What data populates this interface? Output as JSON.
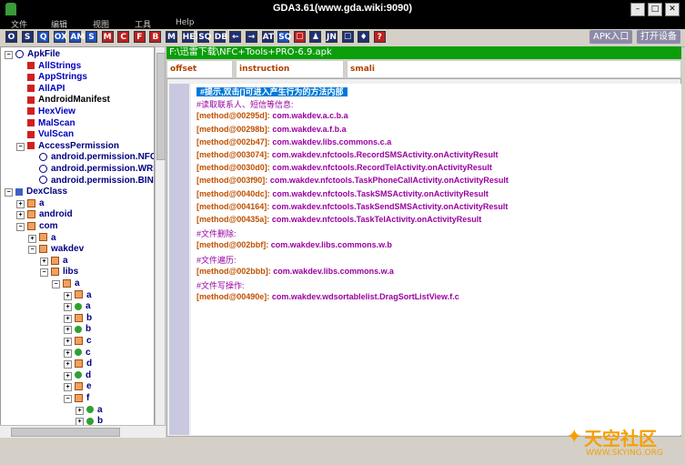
{
  "window": {
    "title": "GDA3.61(www.gda.wiki:9090)"
  },
  "menu": [
    "文件",
    "编辑",
    "视图",
    "工具",
    "Help"
  ],
  "toolbar": {
    "buttons": [
      "O",
      "S",
      "Q",
      "OX",
      "AM",
      "S",
      "M",
      "C",
      "F",
      "B",
      "M",
      "HEX",
      "SQ",
      "DB",
      "←",
      "→",
      "AT",
      "SQ",
      "☐",
      "♟",
      "JN",
      "☐",
      "♦",
      "?"
    ],
    "apk_entry_label": "APK入口",
    "open_device_label": "打开设备"
  },
  "tree": {
    "rows": [
      {
        "label": "ApkFile",
        "depth": 0,
        "expanded": true,
        "icon": "at-icon",
        "color": "#000080"
      },
      {
        "label": "AllStrings",
        "depth": 1,
        "icon": "red-square-icon",
        "color": "#0000c0"
      },
      {
        "label": "AppStrings",
        "depth": 1,
        "icon": "red-square-icon",
        "color": "#0000c0"
      },
      {
        "label": "AllAPI",
        "depth": 1,
        "icon": "red-square-icon",
        "color": "#0000c0"
      },
      {
        "label": "AndroidManifest",
        "depth": 1,
        "icon": "red-square-icon",
        "color": "#000000"
      },
      {
        "label": "HexView",
        "depth": 1,
        "icon": "red-square-icon",
        "color": "#0000c0"
      },
      {
        "label": "MalScan",
        "depth": 1,
        "icon": "red-square-icon",
        "color": "#0000c0"
      },
      {
        "label": "VulScan",
        "depth": 1,
        "icon": "red-square-icon",
        "color": "#0000c0"
      },
      {
        "label": "AccessPermission",
        "depth": 1,
        "expanded": true,
        "icon": "red-square-icon",
        "color": "#000080"
      },
      {
        "label": "android.permission.NFC",
        "depth": 2,
        "icon": "at-icon",
        "color": "#000080"
      },
      {
        "label": "android.permission.WRITE",
        "depth": 2,
        "icon": "at-icon",
        "color": "#000080"
      },
      {
        "label": "android.permission.BIND",
        "depth": 2,
        "icon": "at-icon",
        "color": "#000080"
      },
      {
        "label": "DexClass",
        "depth": 0,
        "expanded": true,
        "icon": "class-tree-icon",
        "color": "#000080"
      },
      {
        "label": "a",
        "depth": 1,
        "collapsed": true,
        "icon": "package-icon",
        "color": "#000080"
      },
      {
        "label": "android",
        "depth": 1,
        "collapsed": true,
        "icon": "package-icon",
        "color": "#000080"
      },
      {
        "label": "com",
        "depth": 1,
        "expanded": true,
        "icon": "package-icon",
        "color": "#000080"
      },
      {
        "label": "a",
        "depth": 2,
        "collapsed": true,
        "icon": "package-icon",
        "color": "#000080"
      },
      {
        "label": "wakdev",
        "depth": 2,
        "expanded": true,
        "icon": "package-icon",
        "color": "#000080"
      },
      {
        "label": "a",
        "depth": 3,
        "collapsed": true,
        "icon": "package-icon",
        "color": "#000080"
      },
      {
        "label": "libs",
        "depth": 3,
        "expanded": true,
        "icon": "package-icon",
        "color": "#000080"
      },
      {
        "label": "a",
        "depth": 4,
        "expanded": true,
        "icon": "package-icon",
        "color": "#000080"
      },
      {
        "label": "a",
        "depth": 5,
        "collapsed": true,
        "icon": "package-icon",
        "color": "#000080"
      },
      {
        "label": "a",
        "depth": 5,
        "collapsed": true,
        "icon": "class-c-icon",
        "color": "#000080"
      },
      {
        "label": "b",
        "depth": 5,
        "collapsed": true,
        "icon": "package-icon",
        "color": "#000080"
      },
      {
        "label": "b",
        "depth": 5,
        "collapsed": true,
        "icon": "class-c-icon",
        "color": "#000080"
      },
      {
        "label": "c",
        "depth": 5,
        "collapsed": true,
        "icon": "package-icon",
        "color": "#000080"
      },
      {
        "label": "c",
        "depth": 5,
        "collapsed": true,
        "icon": "class-c-icon",
        "color": "#000080"
      },
      {
        "label": "d",
        "depth": 5,
        "collapsed": true,
        "icon": "package-icon",
        "color": "#000080"
      },
      {
        "label": "d",
        "depth": 5,
        "collapsed": true,
        "icon": "class-c-icon",
        "color": "#000080"
      },
      {
        "label": "e",
        "depth": 5,
        "collapsed": true,
        "icon": "package-icon",
        "color": "#000080"
      },
      {
        "label": "f",
        "depth": 5,
        "expanded": true,
        "icon": "package-icon",
        "color": "#000080"
      },
      {
        "label": "a",
        "depth": 6,
        "collapsed": true,
        "icon": "class-c-icon",
        "color": "#000080"
      },
      {
        "label": "b",
        "depth": 6,
        "collapsed": true,
        "icon": "class-c-icon",
        "color": "#000080"
      }
    ]
  },
  "path": "F:\\迅雷下载\\NFC+Tools+PRO-6.9.apk",
  "columns": [
    "offset",
    "instruction",
    "smali"
  ],
  "code": [
    {
      "type": "header",
      "text": "#提示,双击[]可进入产生行为的方法内部"
    },
    {
      "type": "comment",
      "text": "#读取联系人、短信等信息:"
    },
    {
      "type": "entry",
      "offset": "[method@00295d]:",
      "sig": "com.wakdev.a.c.b.a"
    },
    {
      "type": "entry",
      "offset": "[method@00298b]:",
      "sig": "com.wakdev.a.f.b.a"
    },
    {
      "type": "entry",
      "offset": "[method@002b47]:",
      "sig": "com.wakdev.libs.commons.c.a"
    },
    {
      "type": "entry",
      "offset": "[method@003074]:",
      "sig": "com.wakdev.nfctools.RecordSMSActivity.onActivityResult"
    },
    {
      "type": "entry",
      "offset": "[method@0030d0]:",
      "sig": "com.wakdev.nfctools.RecordTelActivity.onActivityResult"
    },
    {
      "type": "entry",
      "offset": "[method@003f90]:",
      "sig": "com.wakdev.nfctools.TaskPhoneCallActivity.onActivityResult"
    },
    {
      "type": "entry",
      "offset": "[method@0040dc]:",
      "sig": "com.wakdev.nfctools.TaskSMSActivity.onActivityResult"
    },
    {
      "type": "entry",
      "offset": "[method@004164]:",
      "sig": "com.wakdev.nfctools.TaskSendSMSActivity.onActivityResult"
    },
    {
      "type": "entry",
      "offset": "[method@00435a]:",
      "sig": "com.wakdev.nfctools.TaskTelActivity.onActivityResult"
    },
    {
      "type": "comment",
      "text": "#文件删除:"
    },
    {
      "type": "entry",
      "offset": "[method@002bbf]:",
      "sig": "com.wakdev.libs.commons.w.b"
    },
    {
      "type": "comment",
      "text": "#文件遍历:"
    },
    {
      "type": "entry",
      "offset": "[method@002bbb]:",
      "sig": "com.wakdev.libs.commons.w.a"
    },
    {
      "type": "comment",
      "text": "#文件写操作:"
    },
    {
      "type": "entry",
      "offset": "[method@00490e]:",
      "sig": "com.wakdev.wdsortablelist.DragSortListView.f.c"
    }
  ],
  "watermark": {
    "title": "天空社区",
    "url": "WWW.SKYING.ORG"
  },
  "colors": {
    "path_bar": "#0a9e0a",
    "offset": "#c05000",
    "signature": "#9a00a0",
    "header_highlight": "#0078d7",
    "gutter": "#c8c8e0"
  }
}
